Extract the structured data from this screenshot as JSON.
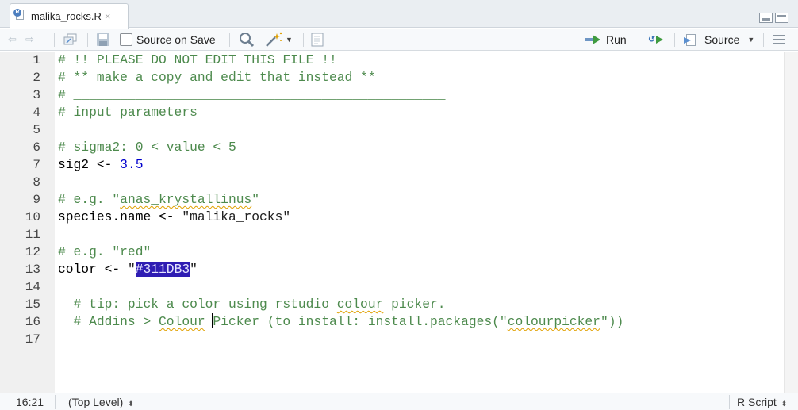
{
  "tab": {
    "title": "malika_rocks.R",
    "close_glyph": "×",
    "icon": "r-file-icon"
  },
  "toolbar": {
    "source_on_save_label": "Source on Save",
    "run_label": "Run",
    "source_label": "Source",
    "back_glyph": "⇦",
    "forward_glyph": "⇨",
    "icons": [
      "back-arrow-icon",
      "forward-arrow-icon",
      "show-in-window-icon",
      "save-icon",
      "search-icon",
      "magic-wand-icon",
      "compile-report-icon",
      "run-icon",
      "rerun-icon",
      "source-icon",
      "document-outline-icon"
    ]
  },
  "editor": {
    "lines": [
      {
        "n": "1",
        "segments": [
          {
            "t": "# !! PLEASE DO NOT EDIT THIS FILE !!",
            "c": "c-comment"
          }
        ]
      },
      {
        "n": "2",
        "segments": [
          {
            "t": "# ** make a copy and edit that instead **",
            "c": "c-comment"
          }
        ]
      },
      {
        "n": "3",
        "segments": [
          {
            "t": "# ________________________________________________",
            "c": "c-comment"
          }
        ]
      },
      {
        "n": "4",
        "segments": [
          {
            "t": "# input parameters",
            "c": "c-comment"
          }
        ]
      },
      {
        "n": "5",
        "segments": []
      },
      {
        "n": "6",
        "segments": [
          {
            "t": "# sigma2: 0 < value < 5",
            "c": "c-comment"
          }
        ]
      },
      {
        "n": "7",
        "segments": [
          {
            "t": "sig2 <- ",
            "c": "c-plain"
          },
          {
            "t": "3.5",
            "c": "c-num"
          }
        ]
      },
      {
        "n": "8",
        "segments": []
      },
      {
        "n": "9",
        "segments": [
          {
            "t": "# e.g. \"",
            "c": "c-comment"
          },
          {
            "t": "anas_krystallinus",
            "c": "c-comment squig"
          },
          {
            "t": "\"",
            "c": "c-comment"
          }
        ]
      },
      {
        "n": "10",
        "segments": [
          {
            "t": "species.name <- ",
            "c": "c-plain"
          },
          {
            "t": "\"malika_rocks\"",
            "c": "c-str"
          }
        ]
      },
      {
        "n": "11",
        "segments": []
      },
      {
        "n": "12",
        "segments": [
          {
            "t": "# e.g. \"red\"",
            "c": "c-comment"
          }
        ]
      },
      {
        "n": "13",
        "segments": [
          {
            "t": "color <- ",
            "c": "c-plain"
          },
          {
            "t": "\"",
            "c": "c-str"
          },
          {
            "t": "#311DB3",
            "c": "sel"
          },
          {
            "t": "\"",
            "c": "c-str"
          }
        ]
      },
      {
        "n": "14",
        "segments": []
      },
      {
        "n": "15",
        "segments": [
          {
            "t": "  # tip: pick a color using rstudio ",
            "c": "c-comment"
          },
          {
            "t": "colour",
            "c": "c-comment squig"
          },
          {
            "t": " picker.",
            "c": "c-comment"
          }
        ]
      },
      {
        "n": "16",
        "segments": [
          {
            "t": "  # Addins > ",
            "c": "c-comment"
          },
          {
            "t": "Colour",
            "c": "c-comment squig"
          },
          {
            "t": " ",
            "c": "c-comment"
          },
          {
            "cursor": true
          },
          {
            "t": "Picker (to install: install.packages(\"",
            "c": "c-comment"
          },
          {
            "t": "colourpicker",
            "c": "c-comment squig"
          },
          {
            "t": "\"))",
            "c": "c-comment"
          }
        ]
      },
      {
        "n": "17",
        "segments": []
      }
    ],
    "selected_color": "#311DB3"
  },
  "status": {
    "position": "16:21",
    "scope": "(Top Level)",
    "file_type": "R Script",
    "updown_glyph": "⬍"
  },
  "colors": {
    "comment": "#4d8a4d",
    "number": "#0000cd",
    "selection": "#2f1db3",
    "gutter_bg": "#f0f0f0"
  }
}
